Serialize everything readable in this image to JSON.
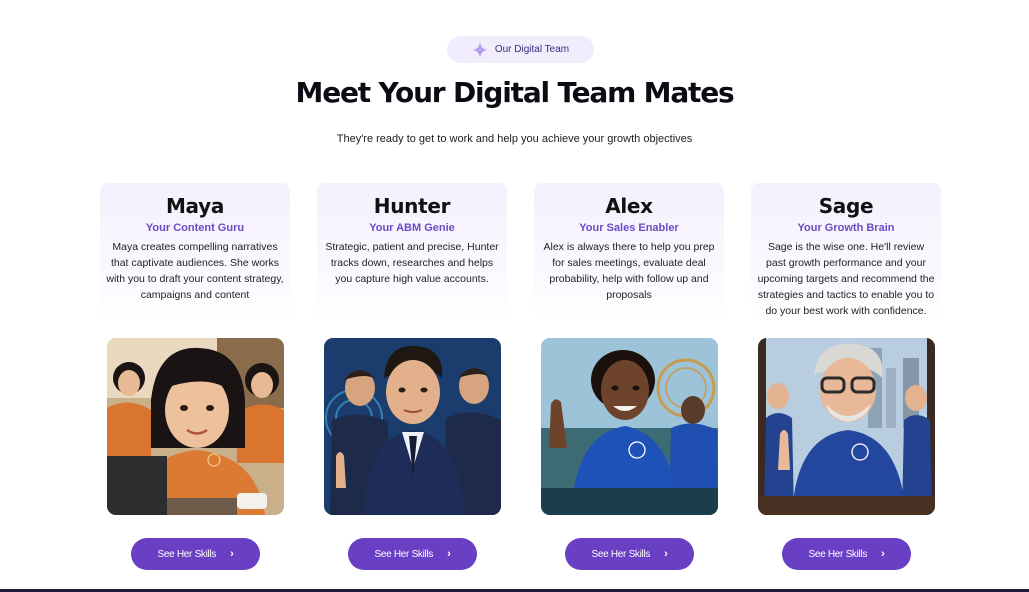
{
  "badge": {
    "label": "Our Digital Team",
    "icon": "sparkle-icon"
  },
  "header": {
    "title": "Meet Your Digital Team Mates",
    "subtitle": "They're ready to get to work and help you achieve your growth objectives"
  },
  "colors": {
    "accent": "#6940c4",
    "role": "#6b4bc4",
    "badge_bg": "#f1edfd"
  },
  "team": [
    {
      "name": "Maya",
      "role": "Your Content Guru",
      "description": "Maya creates compelling narratives that captivate audiences. She works with you to draft your content strategy, campaigns and content",
      "button": "See Her Skills"
    },
    {
      "name": "Hunter",
      "role": "Your ABM Genie",
      "description": "Strategic, patient and precise, Hunter tracks down, researches and helps you capture high value accounts.",
      "button": "See Her Skills"
    },
    {
      "name": "Alex",
      "role": "Your Sales Enabler",
      "description": "Alex is always there to help you prep for sales meetings, evaluate deal probability, help with follow up and proposals",
      "button": "See Her Skills"
    },
    {
      "name": "Sage",
      "role": "Your Growth Brain",
      "description": "Sage is the wise one. He'll review past growth performance and your upcoming targets and recommend the strategies and tactics to enable you to do your best work with confidence.",
      "button": "See Her Skills"
    }
  ]
}
